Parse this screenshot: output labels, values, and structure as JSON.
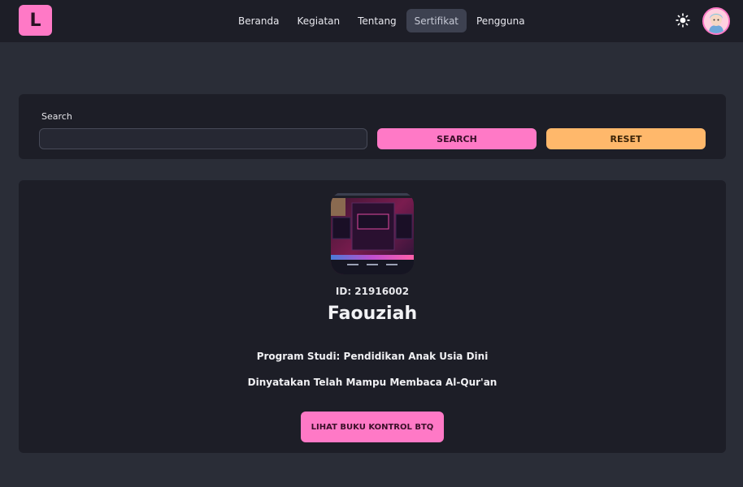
{
  "navbar": {
    "logo_letter": "L",
    "items": [
      {
        "label": "Beranda"
      },
      {
        "label": "Kegiatan"
      },
      {
        "label": "Tentang"
      },
      {
        "label": "Sertifikat",
        "active": true
      },
      {
        "label": "Pengguna"
      }
    ],
    "theme_icon": "sun-icon",
    "avatar_icon": "user-avatar"
  },
  "search": {
    "label": "Search",
    "value": "",
    "placeholder": "",
    "search_button": "SEARCH",
    "reset_button": "RESET"
  },
  "certificate": {
    "photo": "certificate-photo",
    "id_text": "ID: 21916002",
    "name": "Faouziah",
    "program_text": "Program Studi: Pendidikan Anak Usia Dini",
    "status_text": "Dinyatakan Telah Mampu Membaca Al-Qur'an",
    "button_label": "LIHAT BUKU KONTROL BTQ"
  },
  "colors": {
    "background": "#2a2d37",
    "surface": "#1d1e27",
    "primary": "#ff79c6",
    "secondary": "#ffb86b",
    "nav_active": "#3d4150"
  }
}
